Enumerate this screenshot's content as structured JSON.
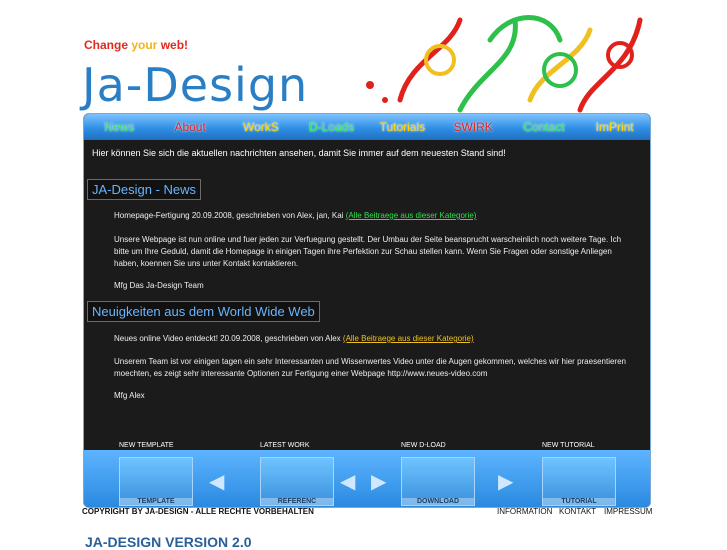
{
  "header": {
    "tagline_parts": [
      "Change ",
      "your ",
      "web!"
    ],
    "logo": "Ja-Design"
  },
  "nav": {
    "items": [
      {
        "label": "News",
        "color": "#2ee65a"
      },
      {
        "label": "About",
        "color": "#e0211c"
      },
      {
        "label": "WorkS",
        "color": "#ffd400"
      },
      {
        "label": "D-Loads",
        "color": "#2ee65a"
      },
      {
        "label": "Tutorials",
        "color": "#ffd400"
      },
      {
        "label": "SWIRK",
        "color": "#e0211c"
      },
      {
        "label": "Contact",
        "color": "#2ee65a"
      },
      {
        "label": "ImPrint",
        "color": "#ffd400"
      }
    ]
  },
  "content": {
    "intro": "Hier können Sie sich die aktuellen nachrichten ansehen, damit Sie immer auf dem neuesten Stand sind!",
    "section1": {
      "title": "JA-Design - News",
      "meta": "Homepage-Fertigung 20.09.2008, geschrieben von Alex, jan, Kai ",
      "link": "(Alle Beitraege aus dieser Kategorie)",
      "body": "Unsere Webpage ist nun online und fuer jeden zur Verfuegung gestellt. Der Umbau der Seite beansprucht warscheinlich noch weitere Tage. Ich bitte um Ihre Geduld, damit die Homepage in einigen Tagen ihre Perfektion zur Schau stellen kann. Wenn Sie Fragen oder sonstige Anliegen haben, koennen Sie uns unter Kontakt kontaktieren.",
      "sign": "Mfg Das Ja-Design Team"
    },
    "section2": {
      "title": "Neuigkeiten aus dem World Wide Web",
      "meta": "Neues online Video entdeckt! 20.09.2008, geschrieben von Alex ",
      "link": "(Alle Beitraege aus dieser Kategorie)",
      "body": "Unserem Team ist vor einigen tagen ein sehr Interessanten und Wissenwertes Video unter die Augen gekommen, welches wir hier praesentieren moechten, es zeigt sehr interessante Optionen zur Fertigung einer Webpage http://www.neues-video.com",
      "sign": "Mfg Alex"
    }
  },
  "showcase": {
    "labels": [
      "NEW TEMPLATE",
      "LATEST WORK",
      "NEW D-LOAD",
      "NEW TUTORIAL"
    ],
    "captions": [
      "TEMPLATE",
      "REFERENC",
      "DOWNLOAD",
      "TUTORIAL"
    ]
  },
  "footer": {
    "copyright": "COPYRIGHT BY JA-DESIGN - ALLE RECHTE VORBEHALTEN",
    "links": [
      "INFORMATION",
      "KONTAKT",
      "IMPRESSUM"
    ],
    "version": "JA-DESIGN VERSION 2.0"
  }
}
